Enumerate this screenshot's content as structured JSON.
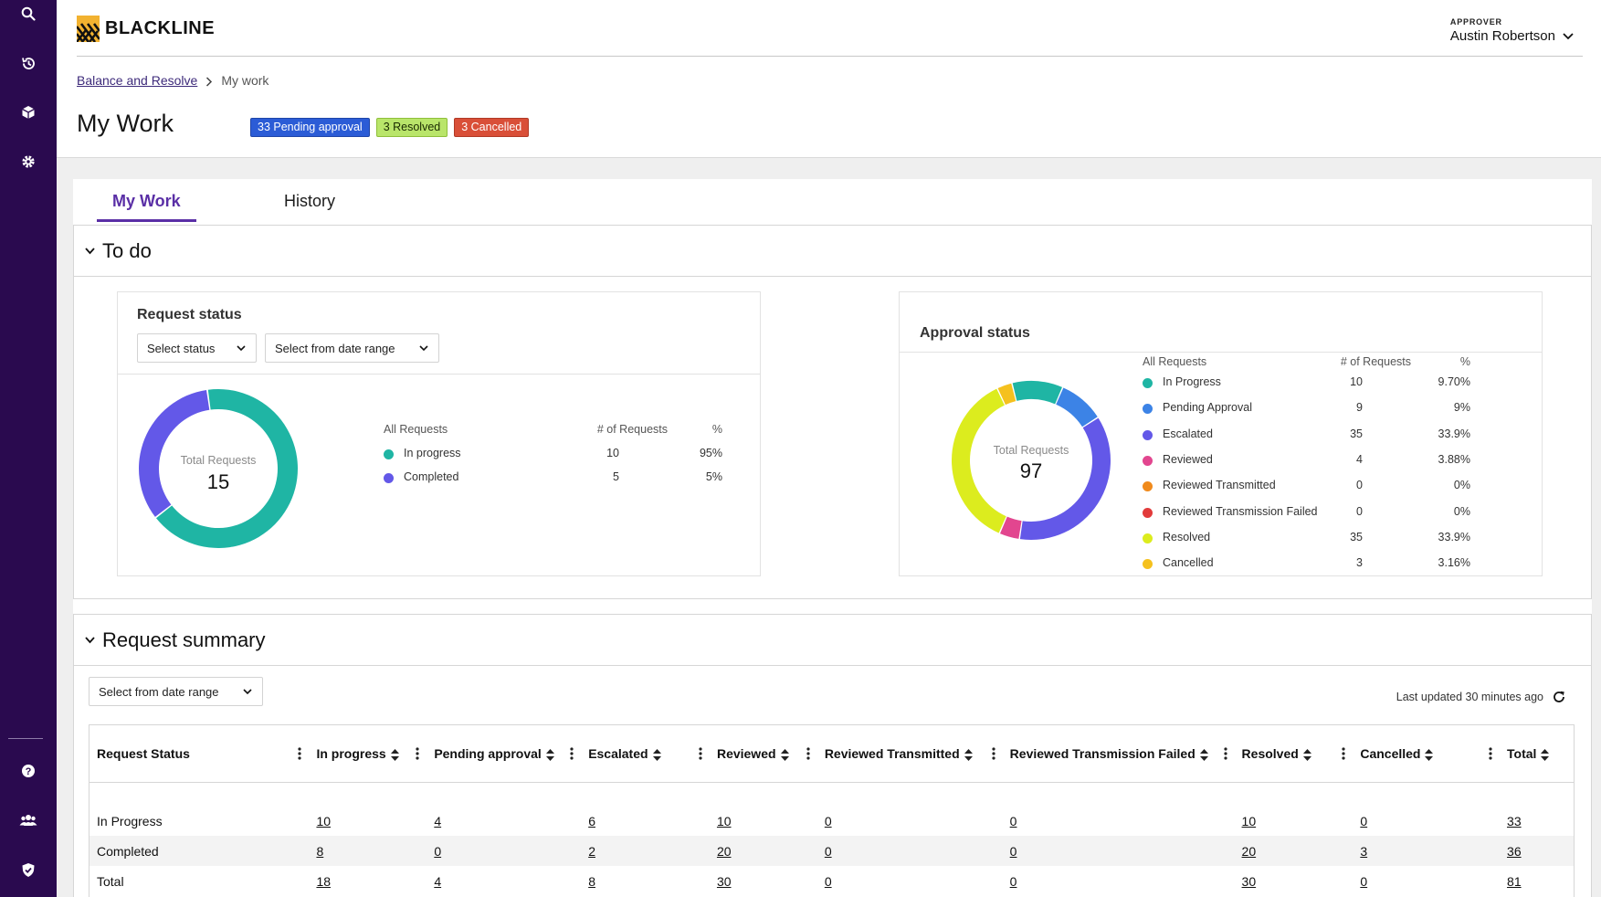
{
  "sidebar": {
    "top_icons": [
      "search-icon",
      "history-icon",
      "cube-icon",
      "settings-icon"
    ],
    "bottom_icons": [
      "help-icon",
      "users-icon",
      "shield-icon"
    ]
  },
  "header": {
    "brand": "BLACKLINE",
    "user_role": "APPROVER",
    "user_name": "Austin Robertson"
  },
  "breadcrumb": {
    "parent": "Balance and Resolve",
    "current": "My work"
  },
  "page": {
    "title": "My Work",
    "badges": {
      "pending": "33 Pending approval",
      "resolved": "3 Resolved",
      "cancelled": "3 Cancelled"
    }
  },
  "tabs": {
    "my_work": "My Work",
    "history": "History"
  },
  "todo": {
    "title": "To do",
    "request_status": {
      "title": "Request status",
      "status_placeholder": "Select status",
      "date_placeholder": "Select from date range",
      "donut_label": "Total Requests",
      "donut_value": "15",
      "legend_headers": {
        "label": "All Requests",
        "count": "# of Requests",
        "pct": "%"
      },
      "rows": [
        {
          "label": "In progress",
          "count": "10",
          "pct": "95%",
          "color": "#1fb5a4"
        },
        {
          "label": "Completed",
          "count": "5",
          "pct": "5%",
          "color": "#6358e8"
        }
      ]
    },
    "approval_status": {
      "title": "Approval status",
      "donut_label": "Total Requests",
      "donut_value": "97",
      "legend_headers": {
        "label": "All Requests",
        "count": "# of Requests",
        "pct": "%"
      },
      "rows": [
        {
          "label": "In Progress",
          "count": "10",
          "pct": "9.70%",
          "color": "#1fb5a4"
        },
        {
          "label": "Pending Approval",
          "count": "9",
          "pct": "9%",
          "color": "#3c83e6"
        },
        {
          "label": "Escalated",
          "count": "35",
          "pct": "33.9%",
          "color": "#6358e8"
        },
        {
          "label": "Reviewed",
          "count": "4",
          "pct": "3.88%",
          "color": "#e2468f"
        },
        {
          "label": "Reviewed Transmitted",
          "count": "0",
          "pct": "0%",
          "color": "#f08a1c"
        },
        {
          "label": "Reviewed Transmission Failed",
          "count": "0",
          "pct": "0%",
          "color": "#e23b3b"
        },
        {
          "label": "Resolved",
          "count": "35",
          "pct": "33.9%",
          "color": "#dcec1e"
        },
        {
          "label": "Cancelled",
          "count": "3",
          "pct": "3.16%",
          "color": "#f5c11e"
        }
      ]
    }
  },
  "summary": {
    "title": "Request summary",
    "date_placeholder": "Select from date range",
    "last_updated": "Last updated 30 minutes ago",
    "columns": [
      "Request Status",
      "In progress",
      "Pending approval",
      "Escalated",
      "Reviewed",
      "Reviewed Transmitted",
      "Reviewed Transmission Failed",
      "Resolved",
      "Cancelled",
      "Total"
    ],
    "rows": [
      [
        "In Progress",
        "10",
        "4",
        "6",
        "10",
        "0",
        "0",
        "10",
        "0",
        "33"
      ],
      [
        "Completed",
        "8",
        "0",
        "2",
        "20",
        "0",
        "0",
        "20",
        "3",
        "36"
      ],
      [
        "Total",
        "18",
        "4",
        "8",
        "30",
        "0",
        "0",
        "30",
        "0",
        "81"
      ]
    ]
  }
}
